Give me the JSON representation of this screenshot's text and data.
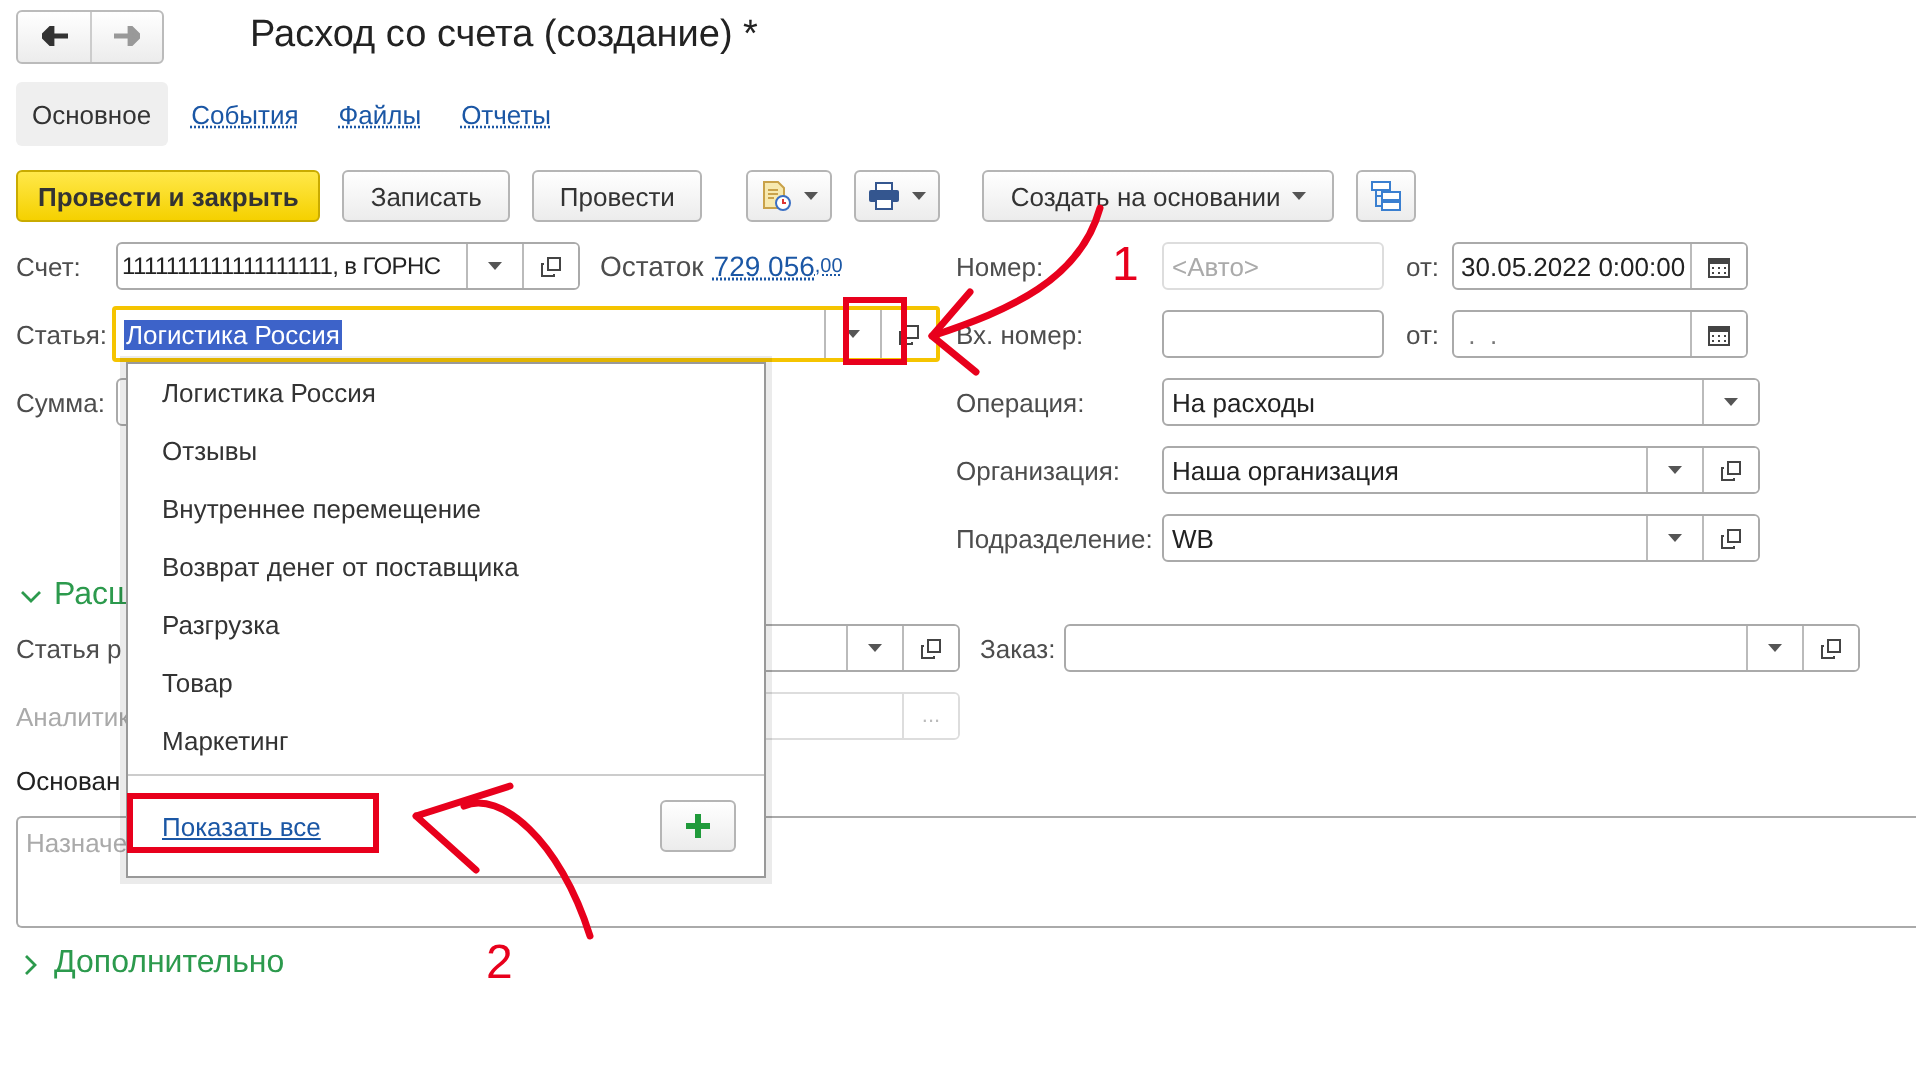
{
  "window": {
    "title": "Расход со счета (создание) *"
  },
  "tabs": [
    {
      "label": "Основное",
      "selected": true
    },
    {
      "label": "События",
      "selected": false
    },
    {
      "label": "Файлы",
      "selected": false
    },
    {
      "label": "Отчеты",
      "selected": false
    }
  ],
  "toolbar": [
    {
      "kind": "primary",
      "label": "Провести и закрыть"
    },
    {
      "kind": "plain",
      "label": "Записать"
    },
    {
      "kind": "plain",
      "label": "Провести"
    },
    {
      "kind": "report-menu"
    },
    {
      "kind": "print-menu"
    },
    {
      "kind": "menu",
      "label": "Создать на основании"
    },
    {
      "kind": "structure"
    }
  ],
  "account": {
    "label": "Счет:",
    "value": "1111111111111111111, в ГОРНС",
    "balance_label": "Остаток",
    "balance": "729 056",
    "balance_cents": ",00"
  },
  "article": {
    "label": "Статья:",
    "value": "Логистика Россия",
    "focused": true
  },
  "sum": {
    "label": "Сумма:"
  },
  "number": {
    "label": "Номер:",
    "placeholder": "<Авто>",
    "date_label": "от:",
    "date": "30.05.2022  0:00:00"
  },
  "incoming": {
    "label": "Вх. номер:",
    "date_label": "от:",
    "date": " .  ."
  },
  "fields": [
    {
      "label": "Операция:",
      "value": "На расходы",
      "open_button": false
    },
    {
      "label": "Организация:",
      "value": "Наша организация",
      "open_button": true
    },
    {
      "label": "Подразделение:",
      "value": "WB",
      "open_button": true
    }
  ],
  "section": {
    "title": "Расш",
    "expanded": true
  },
  "expense_label": "Статья р",
  "order": {
    "label": "Заказ:"
  },
  "analytics": {
    "label": "Аналитик",
    "disabled": true,
    "button": "..."
  },
  "basis_label": "Основан",
  "purpose": {
    "placeholder": "Назначе"
  },
  "extra_section": {
    "title": "Дополнительно",
    "expanded": false
  },
  "dropdown": {
    "items": [
      "Логистика Россия",
      "Отзывы",
      "Внутреннее перемещение",
      "Возврат денег от поставщика",
      "Разгрузка",
      "Товар",
      "Маркетинг"
    ],
    "show_all": "Показать все"
  },
  "annotations": [
    {
      "label": "1"
    },
    {
      "label": "2"
    }
  ]
}
